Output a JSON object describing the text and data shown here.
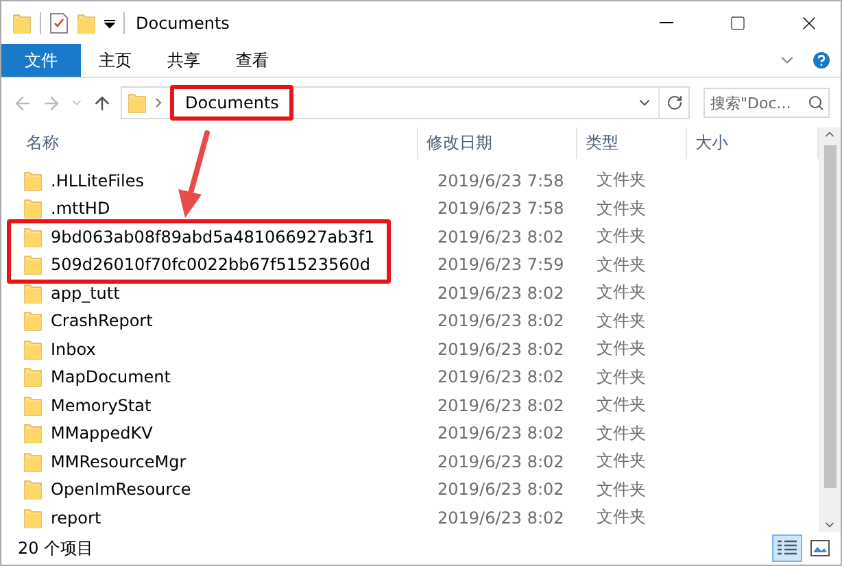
{
  "window": {
    "title": "Documents"
  },
  "ribbon": {
    "tabs": [
      {
        "label": "文件",
        "kind": "file"
      },
      {
        "label": "主页",
        "kind": "tab"
      },
      {
        "label": "共享",
        "kind": "tab"
      },
      {
        "label": "查看",
        "kind": "tab"
      }
    ]
  },
  "address": {
    "path": "Documents",
    "highlighted": true
  },
  "search": {
    "placeholder": "搜索\"Doc..."
  },
  "table": {
    "columns": [
      "名称",
      "修改日期",
      "类型",
      "大小"
    ],
    "rows": [
      {
        "name": ".HLLiteFiles",
        "date": "2019/6/23 7:58",
        "type": "文件夹",
        "highlighted": false
      },
      {
        "name": ".mttHD",
        "date": "2019/6/23 7:58",
        "type": "文件夹",
        "highlighted": false
      },
      {
        "name": "9bd063ab08f89abd5a481066927ab3f1",
        "date": "2019/6/23 8:02",
        "type": "文件夹",
        "highlighted": true
      },
      {
        "name": "509d26010f70fc0022bb67f51523560d",
        "date": "2019/6/23 7:59",
        "type": "文件夹",
        "highlighted": true
      },
      {
        "name": "app_tutt",
        "date": "2019/6/23 8:02",
        "type": "文件夹",
        "highlighted": false
      },
      {
        "name": "CrashReport",
        "date": "2019/6/23 8:02",
        "type": "文件夹",
        "highlighted": false
      },
      {
        "name": "Inbox",
        "date": "2019/6/23 8:02",
        "type": "文件夹",
        "highlighted": false
      },
      {
        "name": "MapDocument",
        "date": "2019/6/23 8:02",
        "type": "文件夹",
        "highlighted": false
      },
      {
        "name": "MemoryStat",
        "date": "2019/6/23 8:02",
        "type": "文件夹",
        "highlighted": false
      },
      {
        "name": "MMappedKV",
        "date": "2019/6/23 8:02",
        "type": "文件夹",
        "highlighted": false
      },
      {
        "name": "MMResourceMgr",
        "date": "2019/6/23 8:02",
        "type": "文件夹",
        "highlighted": false
      },
      {
        "name": "OpenImResource",
        "date": "2019/6/23 8:02",
        "type": "文件夹",
        "highlighted": false
      },
      {
        "name": "report",
        "date": "2019/6/23 8:02",
        "type": "文件夹",
        "highlighted": false
      }
    ]
  },
  "status_bar": {
    "count": "20 个项目",
    "views": [
      {
        "kind": "details",
        "selected": true
      },
      {
        "kind": "large-icons",
        "selected": false
      }
    ]
  }
}
